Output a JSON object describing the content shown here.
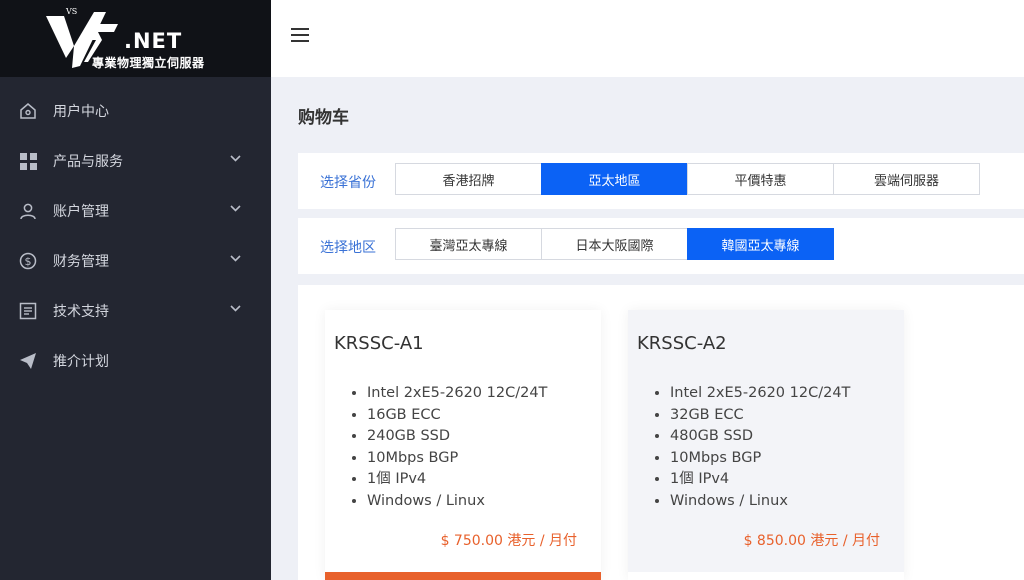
{
  "brand": {
    "name": ".NET",
    "tagline": "專業物理獨立伺服器"
  },
  "sidebar": {
    "items": [
      {
        "label": "用户中心",
        "icon": "home-icon",
        "expandable": false
      },
      {
        "label": "产品与服务",
        "icon": "grid-icon",
        "expandable": true
      },
      {
        "label": "账户管理",
        "icon": "user-icon",
        "expandable": true
      },
      {
        "label": "财务管理",
        "icon": "dollar-icon",
        "expandable": true
      },
      {
        "label": "技术支持",
        "icon": "document-icon",
        "expandable": true
      },
      {
        "label": "推介计划",
        "icon": "send-icon",
        "expandable": false
      }
    ]
  },
  "topbar": {
    "menu_icon": "hamburger-icon"
  },
  "page": {
    "title": "购物车"
  },
  "filters": {
    "province": {
      "label": "选择省份",
      "options": [
        "香港招牌",
        "亞太地區",
        "平價特惠",
        "雲端伺服器"
      ],
      "selected": "亞太地區"
    },
    "region": {
      "label": "选择地区",
      "options": [
        "臺灣亞太專線",
        "日本大阪國際",
        "韓國亞太專線"
      ],
      "selected": "韓國亞太專線"
    }
  },
  "products": [
    {
      "name": "KRSSC-A1",
      "specs": [
        "Intel 2xE5-2620 12C/24T",
        "16GB ECC",
        "240GB SSD",
        "10Mbps BGP",
        "1個 IPv4",
        "Windows / Linux"
      ],
      "price": "$ 750.00 港元 / 月付"
    },
    {
      "name": "KRSSC-A2",
      "specs": [
        "Intel 2xE5-2620 12C/24T",
        "32GB ECC",
        "480GB SSD",
        "10Mbps BGP",
        "1個 IPv4",
        "Windows / Linux"
      ],
      "price": "$ 850.00 港元 / 月付"
    }
  ],
  "colors": {
    "sidebar_bg": "#232631",
    "logo_bg": "#101217",
    "accent_blue": "#0b62f5",
    "label_blue": "#3a72d6",
    "price_orange": "#e8612c"
  }
}
